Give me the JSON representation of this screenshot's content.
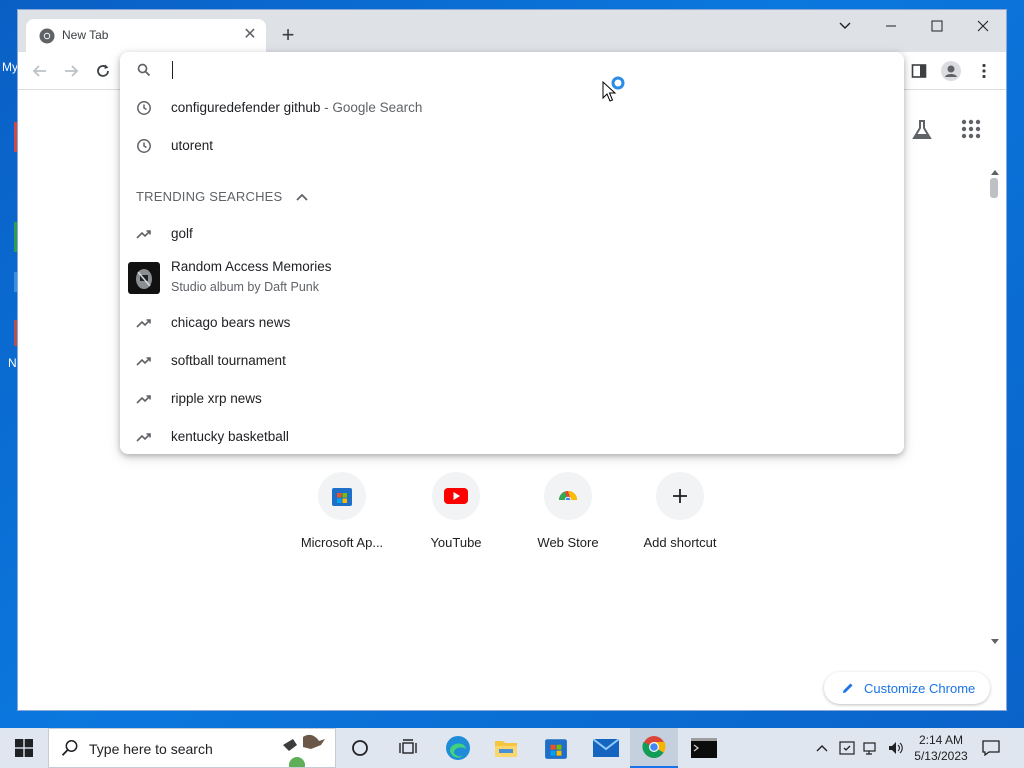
{
  "desktop": {
    "frag_top": "My",
    "frag_bottom": "N"
  },
  "browser": {
    "tab_title": "New Tab",
    "tab_close_glyph": "✕",
    "new_tab_glyph": "+"
  },
  "omnibox": {
    "history": [
      {
        "text": "configuredefender github",
        "suffix": " - Google Search"
      },
      {
        "text": "utorent",
        "suffix": ""
      }
    ],
    "trending_header": "TRENDING SEARCHES",
    "trending": [
      {
        "text": "golf"
      },
      {
        "text": "Random Access Memories",
        "subtitle": "Studio album by Daft Punk",
        "has_thumbnail": true
      },
      {
        "text": "chicago bears news"
      },
      {
        "text": "softball tournament"
      },
      {
        "text": "ripple xrp news"
      },
      {
        "text": "kentucky basketball"
      }
    ]
  },
  "shortcuts": [
    {
      "label": "Microsoft Ap...",
      "icon": "microsoft-store-icon"
    },
    {
      "label": "YouTube",
      "icon": "youtube-icon"
    },
    {
      "label": "Web Store",
      "icon": "chrome-web-store-icon"
    },
    {
      "label": "Add shortcut",
      "icon": "plus-icon"
    }
  ],
  "customize_label": "Customize Chrome",
  "taskbar": {
    "search_placeholder": "Type here to search",
    "time": "2:14 AM",
    "date": "5/13/2023"
  },
  "colors": {
    "accent": "#1a73e8",
    "desktop": "#0a67c7",
    "youtube_red": "#ff0000"
  }
}
